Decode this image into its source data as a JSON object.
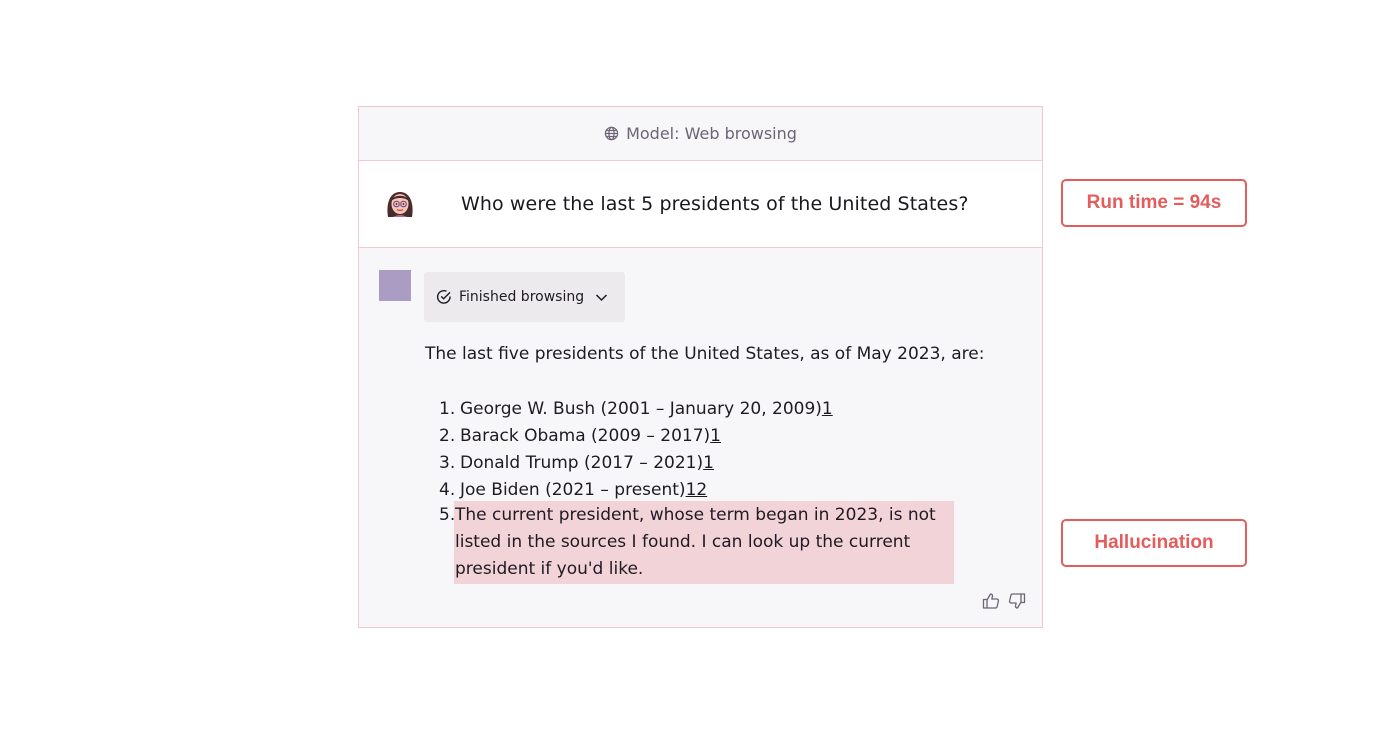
{
  "header": {
    "label": "Model: Web browsing",
    "icon": "globe-icon"
  },
  "question": {
    "text": "Who were the last 5 presidents of the United States?",
    "avatar": "user-avatar"
  },
  "answer": {
    "status_chip": "Finished browsing",
    "intro": "The last five presidents of the United States, as of May 2023, are:",
    "items": [
      {
        "num": "1.",
        "text": "George W. Bush (2001 – January 20, 2009)",
        "cite": "1"
      },
      {
        "num": "2.",
        "text": "Barack Obama (2009 – 2017)",
        "cite": "1"
      },
      {
        "num": "3.",
        "text": "Donald Trump (2017 – 2021)",
        "cite": "1"
      },
      {
        "num": "4.",
        "text": "Joe Biden (2021 – present)",
        "cite": "12"
      },
      {
        "num": "5.",
        "text": "The current president, whose term began in 2023, is not listed in the sources I found. I can look up the current president if you'd like."
      }
    ]
  },
  "annotations": {
    "run_time": "Run time = 94s",
    "hallucination": "Hallucination"
  },
  "colors": {
    "border": "#f2c9d0",
    "highlight": "#f2d3d8",
    "annotation": "#e45c5c",
    "bot_square": "#ab9cc4"
  }
}
